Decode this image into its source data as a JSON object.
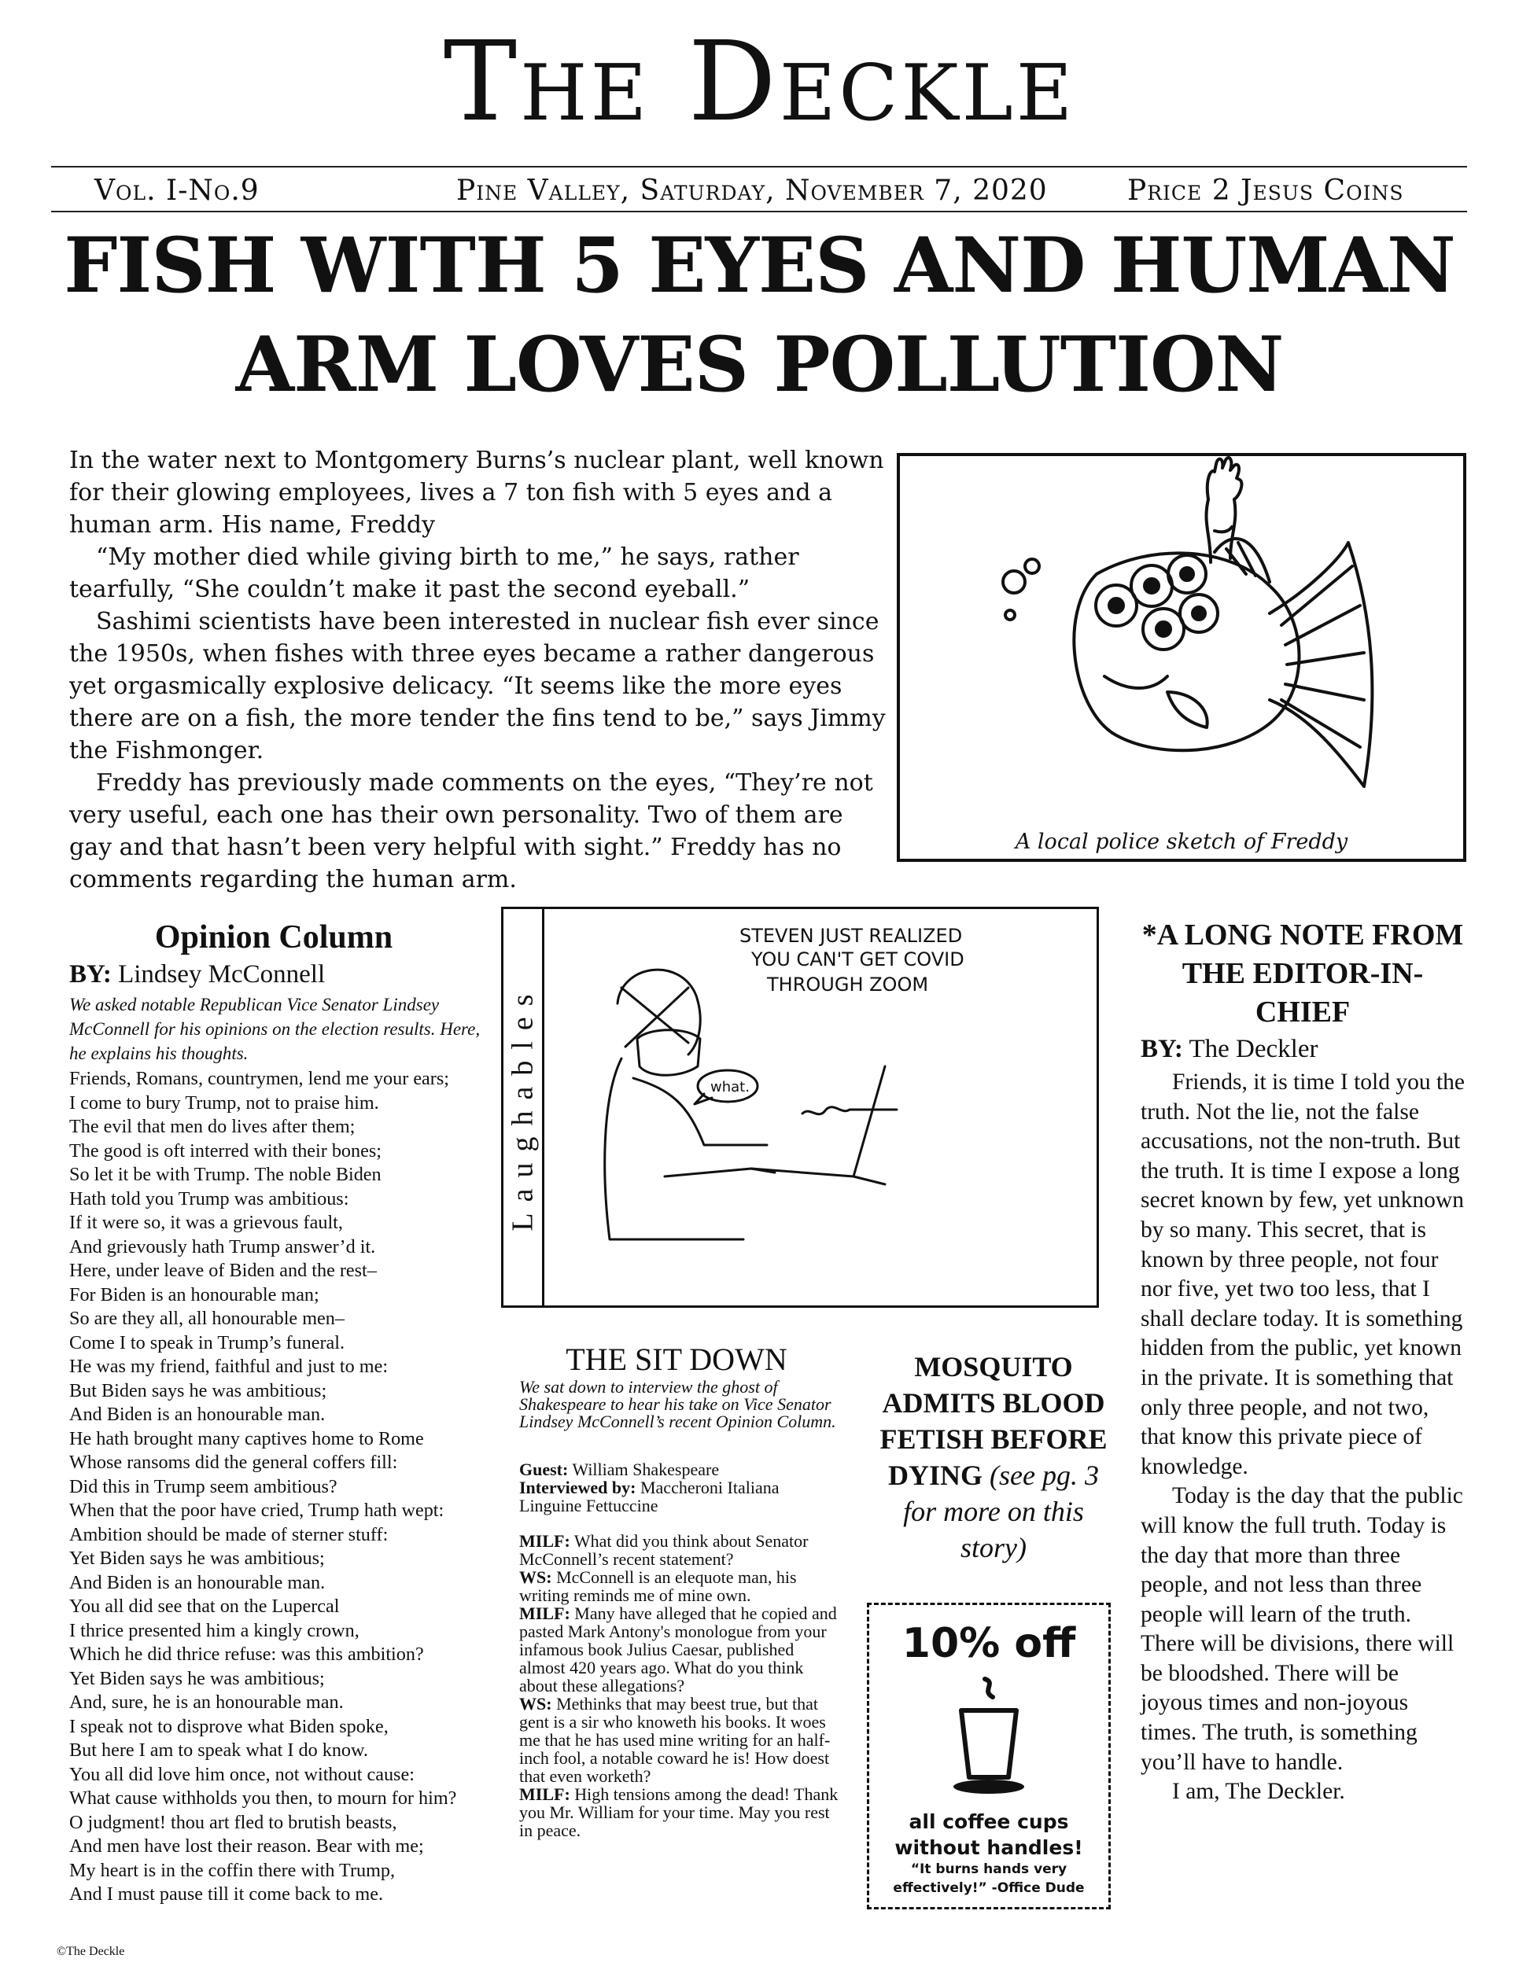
{
  "masthead": {
    "title": "The Deckle"
  },
  "dateline": {
    "volume": "Vol. I-No.9",
    "place_date": "Pine Valley, Saturday, November 7, 2020",
    "price": "Price 2 Jesus Coins"
  },
  "headline": {
    "line1": "FISH WITH 5 EYES AND HUMAN",
    "line2": "ARM LOVES POLLUTION"
  },
  "lead_story": {
    "paragraphs": [
      "In the water next to Montgomery Burns’s nuclear plant, well known for their glowing employees, lives a 7 ton fish with 5 eyes and a human arm. His name, Freddy",
      "“My mother died while giving birth to me,” he says, rather tearfully, “She couldn’t make it past the second eyeball.”",
      "Sashimi scientists have been interested in nuclear fish ever since the 1950s, when fishes with three eyes became a rather dangerous yet orgasmically explosive delicacy. “It seems like the more eyes there are on a fish, the more tender the fins tend to be,” says Jimmy the Fishmonger.",
      "Freddy has previously made comments on the eyes, “They’re not very useful, each one has their own personality. Two of them are gay and that hasn’t been very helpful with sight.” Freddy has no comments regarding the human arm."
    ],
    "figure_caption": "A local police sketch of Freddy"
  },
  "opinion": {
    "title": "Opinion Column",
    "by_label": "BY:",
    "author": "Lindsey McConnell",
    "intro": "We asked notable Republican Vice Senator Lindsey McConnell for his opinions on the election results. Here, he explains his thoughts.",
    "lines": [
      "Friends, Romans, countrymen, lend me your ears;",
      "I come to bury Trump, not to praise him.",
      "The evil that men do lives after them;",
      "The good is oft interred with their bones;",
      "So let it be with Trump. The noble Biden",
      "Hath told you Trump was ambitious:",
      "If it were so, it was a grievous fault,",
      "And grievously hath Trump answer’d it.",
      "Here, under leave of Biden and the rest–",
      "For Biden is an honourable man;",
      "So are they all, all honourable men–",
      "Come I to speak in Trump’s funeral.",
      "He was my friend, faithful and just to me:",
      "But Biden says he was ambitious;",
      "And Biden is an honourable man.",
      "He hath brought many captives home to Rome",
      "Whose ransoms did the general coffers fill:",
      "Did this in Trump seem ambitious?",
      "When that the poor have cried, Trump hath wept:",
      "Ambition should be made of sterner stuff:",
      "Yet Biden says he was ambitious;",
      "And Biden is an honourable man.",
      "You all did see that on the Lupercal",
      "I thrice presented him a kingly crown,",
      "Which he did thrice refuse: was this ambition?",
      "Yet Biden says he was ambitious;",
      "And, sure, he is an honourable man.",
      "I speak not to disprove what Biden spoke,",
      "But here I am to speak what I do know.",
      "You all did love him once, not without cause:",
      "What cause withholds you then, to mourn for him?",
      "O judgment! thou art fled to brutish beasts,",
      "And men have lost their reason. Bear with me;",
      "My heart is in the coffin there with Trump,",
      "And I must pause till it come back to me."
    ],
    "copyright": "©The Deckle"
  },
  "laughables": {
    "label": "Laughables",
    "caption_line1": "STEVEN JUST REALIZED",
    "caption_line2": "YOU CAN'T GET COVID",
    "caption_line3": "THROUGH ZOOM",
    "speech": "what."
  },
  "sit_down": {
    "title": "THE SIT DOWN",
    "intro": "We sat down to interview the ghost of Shakespeare to hear his take on Vice Senator Lindsey McConnell’s recent Opinion Column.",
    "guest_label": "Guest:",
    "guest": "William Shakespeare",
    "interviewer_label": "Interviewed by:",
    "interviewer": "Maccheroni Italiana Linguine Fettuccine",
    "qa": [
      {
        "speaker": "MILF:",
        "text": "What did you think about Senator McConnell’s recent statement?"
      },
      {
        "speaker": "WS:",
        "text": "McConnell is an elequote man, his writing reminds me of mine own."
      },
      {
        "speaker": "MILF:",
        "text": "Many have alleged that he copied and pasted Mark Antony's monologue from your infamous book Julius Caesar, published almost 420 years ago. What do you think about these allegations?"
      },
      {
        "speaker": "WS:",
        "text": "Methinks that may beest true, but that gent is a sir who knoweth his books. It woes me that he has used mine writing for an half-inch fool, a notable coward he is! How doest that even worketh?"
      },
      {
        "speaker": "MILF:",
        "text": "High tensions among the dead! Thank you Mr. William for your time. May you rest in peace."
      }
    ]
  },
  "mosquito": {
    "headline": "MOSQUITO ADMITS BLOOD FETISH BEFORE DYING",
    "note": "(see pg. 3 for more on this story)"
  },
  "coupon": {
    "offer": "10% off",
    "line1": "all coffee cups",
    "line2": "without handles!",
    "quote": "“It burns hands very effectively!” -Office Dude"
  },
  "editor_note": {
    "title": "*A LONG NOTE FROM THE EDITOR-IN-CHIEF",
    "by_label": "BY:",
    "author": "The Deckler",
    "paragraphs": [
      "Friends, it is time I told you the truth. Not the lie, not the false accusations, not the non-truth. But the truth. It is time I expose a long secret known by few, yet unknown by so many. This secret, that is known by three people, not four nor five, yet two too less, that I shall declare today. It is something hidden from the public, yet known in the private. It is something that only three people, and not two, that know this private piece of knowledge.",
      "Today is the day that the public will know the full truth. Today is the day that more than three people, and not less than three people will learn of the truth. There will be divisions, there will be bloodshed. There will be joyous times and non-joyous times. The truth, is something you’ll have to handle.",
      "I am, The Deckler."
    ]
  }
}
